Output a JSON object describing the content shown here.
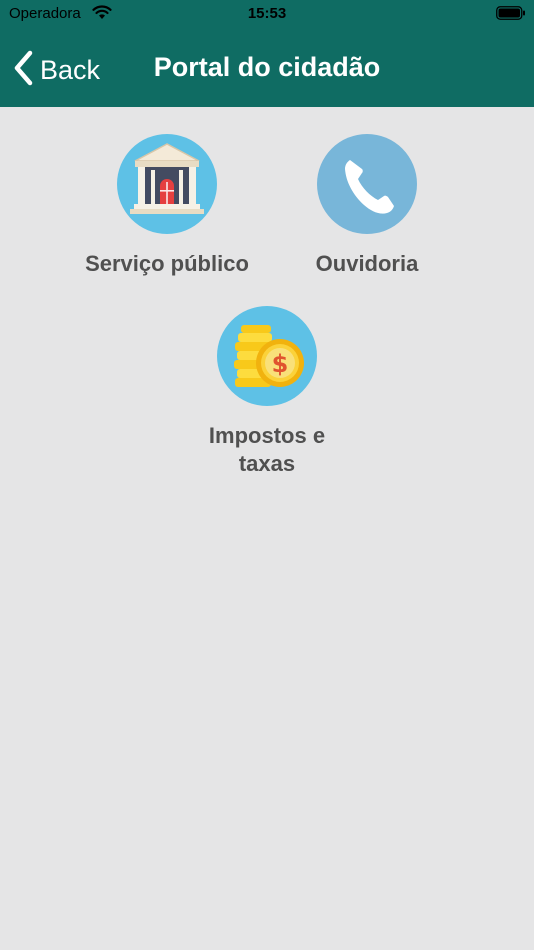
{
  "status_bar": {
    "carrier": "Operadora",
    "time": "15:53"
  },
  "nav": {
    "back_label": "Back",
    "title": "Portal do cidadão"
  },
  "tiles": [
    {
      "label": "Serviço público",
      "icon": "bank-icon",
      "bg": "#5ec1e6"
    },
    {
      "label": "Ouvidoria",
      "icon": "phone-icon",
      "bg": "#78b6d9"
    },
    {
      "label": "Impostos e taxas",
      "icon": "coins-icon",
      "bg": "#5ec1e6"
    }
  ],
  "colors": {
    "header": "#0f6c63",
    "background": "#e5e5e6",
    "label": "#505050"
  }
}
